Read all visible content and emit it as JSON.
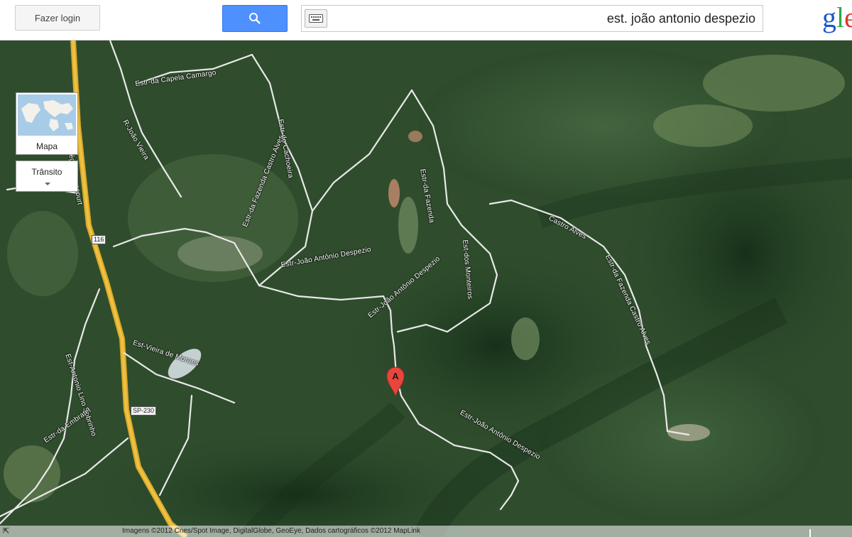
{
  "header": {
    "login_label": "Fazer login",
    "search_icon": "search-icon",
    "keyboard_icon": "keyboard-icon",
    "search_query": "est. joão antonio despezio",
    "logo_text": "gle"
  },
  "map_controls": {
    "map_type_label": "Mapa",
    "traffic_label": "Trânsito"
  },
  "map": {
    "marker_label": "A",
    "road_labels": {
      "capela_camargo": "Estr-da Capela Camargo",
      "joao_vieira": "R-João Vieira",
      "cachoeira": "Estr-do Cachoeira",
      "fazenda_castro_alves_1": "Estr-da Fazenda Castro Alves",
      "joao_antonio_despezio_1": "Estr-João Antônio Despezio",
      "joao_antonio_despezio_2": "Estr-João Antônio Despezio",
      "joao_antonio_despezio_3": "Estr-João Antônio Despezio",
      "fazenda_upper": "Estr-da Fazenda",
      "castro_alves": "Castro Alves",
      "fazenda_castro_alves_2": "Estr-da Fazenda Castro Alves",
      "est_monteiros": "Est-dos Monteiros",
      "rod_regis": "Rod-Régis Bittencourt",
      "vieira_moraes": "Est-Vieira de Moraes",
      "lino_sobrinho": "Est-Antonio Lino Sobrinho",
      "embratel": "Estr-da Embratel"
    },
    "shields": {
      "br116_top": "116",
      "br116_side": "116",
      "sp230": "SP-230"
    },
    "attribution": "Imagens ©2012 Cnes/Spot Image, DigitalGlobe, GeoEye, Dados cartográficos ©2012 MapLink",
    "colors": {
      "forest_dark": "#1f3a1e",
      "forest_mid": "#35563a",
      "clearing": "#6f8a5a",
      "road": "#e9e9e9",
      "highway": "#f0c040",
      "marker": "#e8463c",
      "search_button": "#4d90fe"
    }
  }
}
